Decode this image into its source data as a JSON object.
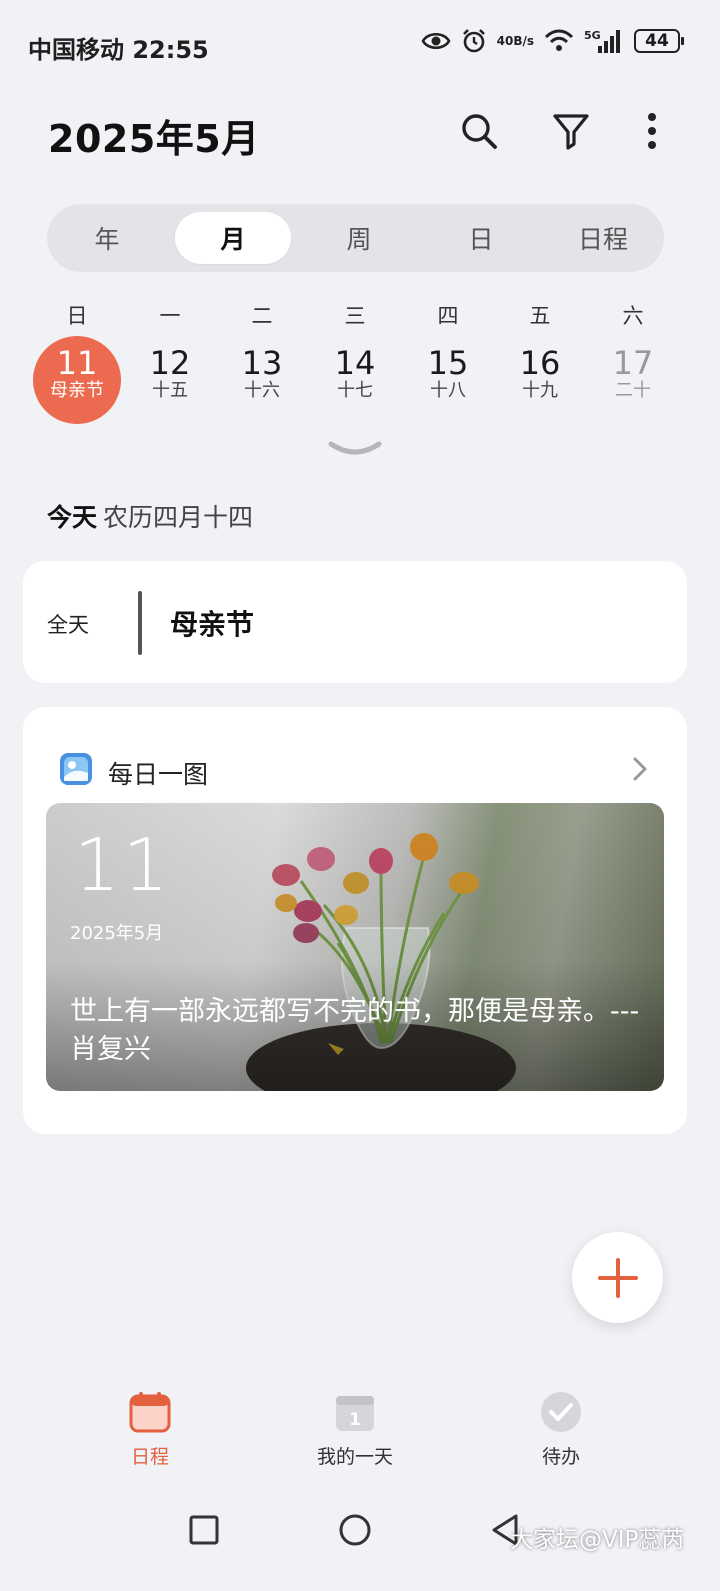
{
  "status_bar": {
    "carrier_time": "中国移动 22:55",
    "net_speed_value": "40",
    "net_speed_unit": "B/s",
    "network": "5G",
    "battery": "44",
    "icons": [
      "eye-icon",
      "alarm-icon",
      "wifi-icon",
      "signal-icon",
      "battery-icon"
    ]
  },
  "header": {
    "title": "2025年5月",
    "icons": [
      "search-icon",
      "filter-icon",
      "more-icon"
    ]
  },
  "view_tabs": [
    {
      "label": "年",
      "active": false
    },
    {
      "label": "月",
      "active": true
    },
    {
      "label": "周",
      "active": false
    },
    {
      "label": "日",
      "active": false
    },
    {
      "label": "日程",
      "active": false
    }
  ],
  "weekdays": [
    "日",
    "一",
    "二",
    "三",
    "四",
    "五",
    "六"
  ],
  "days": [
    {
      "num": "11",
      "lunar": "母亲节",
      "today": true
    },
    {
      "num": "12",
      "lunar": "十五"
    },
    {
      "num": "13",
      "lunar": "十六"
    },
    {
      "num": "14",
      "lunar": "十七"
    },
    {
      "num": "15",
      "lunar": "十八"
    },
    {
      "num": "16",
      "lunar": "十九"
    },
    {
      "num": "17",
      "lunar": "二十"
    }
  ],
  "today": {
    "label": "今天",
    "lunar": "农历四月十四"
  },
  "event": {
    "time": "全天",
    "title": "母亲节"
  },
  "daily": {
    "title": "每日一图",
    "day": "11",
    "date": "2025年5月",
    "quote": "世上有一部永远都写不完的书，那便是母亲。--- 肖复兴"
  },
  "bottom_tabs": [
    {
      "label": "日程",
      "active": true
    },
    {
      "label": "我的一天",
      "active": false
    },
    {
      "label": "待办",
      "active": false
    }
  ],
  "watermark": "大家坛@VIP蕊芮",
  "colors": {
    "accent": "#ec6a4f",
    "background": "#f1f2f6"
  }
}
